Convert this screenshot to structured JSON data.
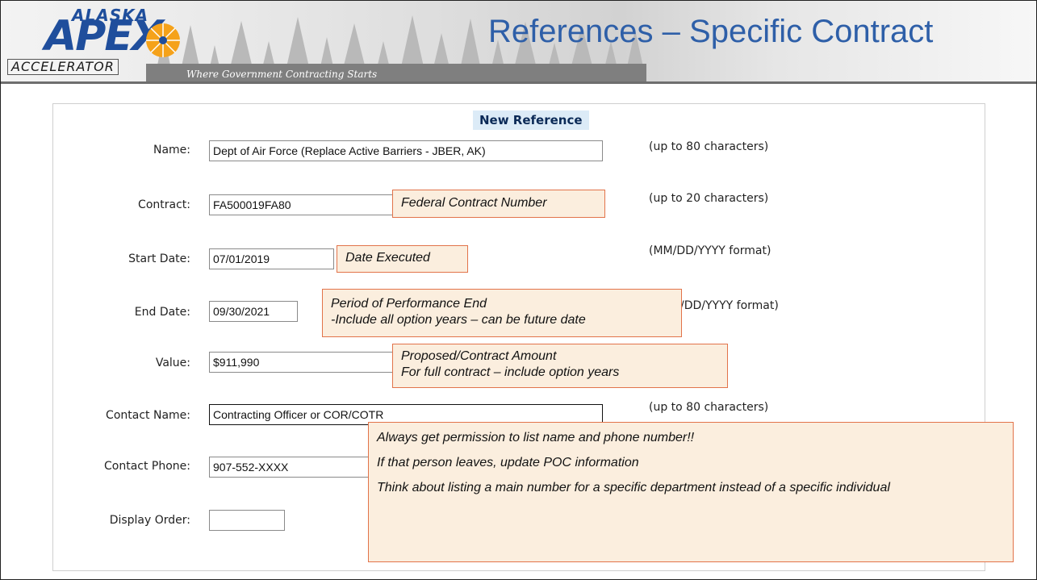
{
  "header": {
    "logo_top": "ALASKA",
    "logo_main": "APEX",
    "logo_bottom": "ACCELERATOR",
    "tagline": "Where Government Contracting Starts",
    "title": "References – Specific Contract"
  },
  "form": {
    "title": "New Reference",
    "rows": [
      {
        "label": "Name:",
        "value": "Dept of Air Force   (Replace Active Barriers - JBER, AK)",
        "hint": "(up to 80 characters)"
      },
      {
        "label": "Contract:",
        "value": "FA500019FA80",
        "hint": "(up to 20 characters)"
      },
      {
        "label": "Start Date:",
        "value": "07/01/2019",
        "hint": "(MM/DD/YYYY format)"
      },
      {
        "label": "End Date:",
        "value": "09/30/2021",
        "hint": "/DD/YYYY format)"
      },
      {
        "label": "Value:",
        "value": "$911,990",
        "hint": ""
      },
      {
        "label": "Contact Name:",
        "value": "Contracting Officer or COR/COTR",
        "hint": "(up to 80 characters)"
      },
      {
        "label": "Contact Phone:",
        "value": "907-552-XXXX",
        "hint": ""
      },
      {
        "label": "Display Order:",
        "value": "",
        "hint": ""
      }
    ]
  },
  "callouts": {
    "contract": "Federal Contract Number",
    "start_date": "Date Executed",
    "end_date": [
      "Period of Performance End",
      "-Include all option years – can be future date"
    ],
    "value": [
      "Proposed/Contract Amount",
      "For full contract – include option years"
    ],
    "contact": [
      "Always get permission to list name and phone number!!",
      "If that person leaves, update POC information",
      "Think about listing a main number for a specific department instead of a specific individual"
    ]
  },
  "colors": {
    "title_blue": "#2e5fa8",
    "callout_fill": "#fbeede",
    "callout_border": "#e2734a",
    "form_title_bg": "#dcebf7"
  }
}
